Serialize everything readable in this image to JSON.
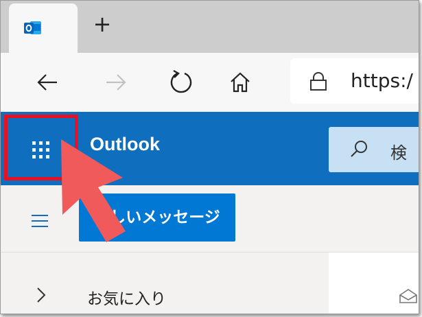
{
  "browser": {
    "tab": {
      "icon": "outlook-icon"
    },
    "new_tab_label": "+",
    "nav": {
      "back_icon": "arrow-left-icon",
      "forward_icon": "arrow-right-icon",
      "refresh_icon": "refresh-icon",
      "home_icon": "home-icon"
    },
    "address": {
      "lock_icon": "lock-icon",
      "url": "https:/"
    }
  },
  "outlook": {
    "app_launcher_icon": "waffle-icon",
    "brand": "Outlook",
    "search": {
      "icon": "search-icon",
      "text": "検"
    },
    "menu_icon": "hamburger-icon",
    "new_message_label": "新しいメッセージ",
    "favorites_label": "お気に入り",
    "favorites_icon": "chevron-right-icon"
  },
  "annotation": {
    "highlight_color": "#e81123",
    "arrow_color": "#f05a5a"
  },
  "colors": {
    "header": "#106ebe",
    "button": "#0078d4",
    "search_bg": "#c7e0f4"
  }
}
